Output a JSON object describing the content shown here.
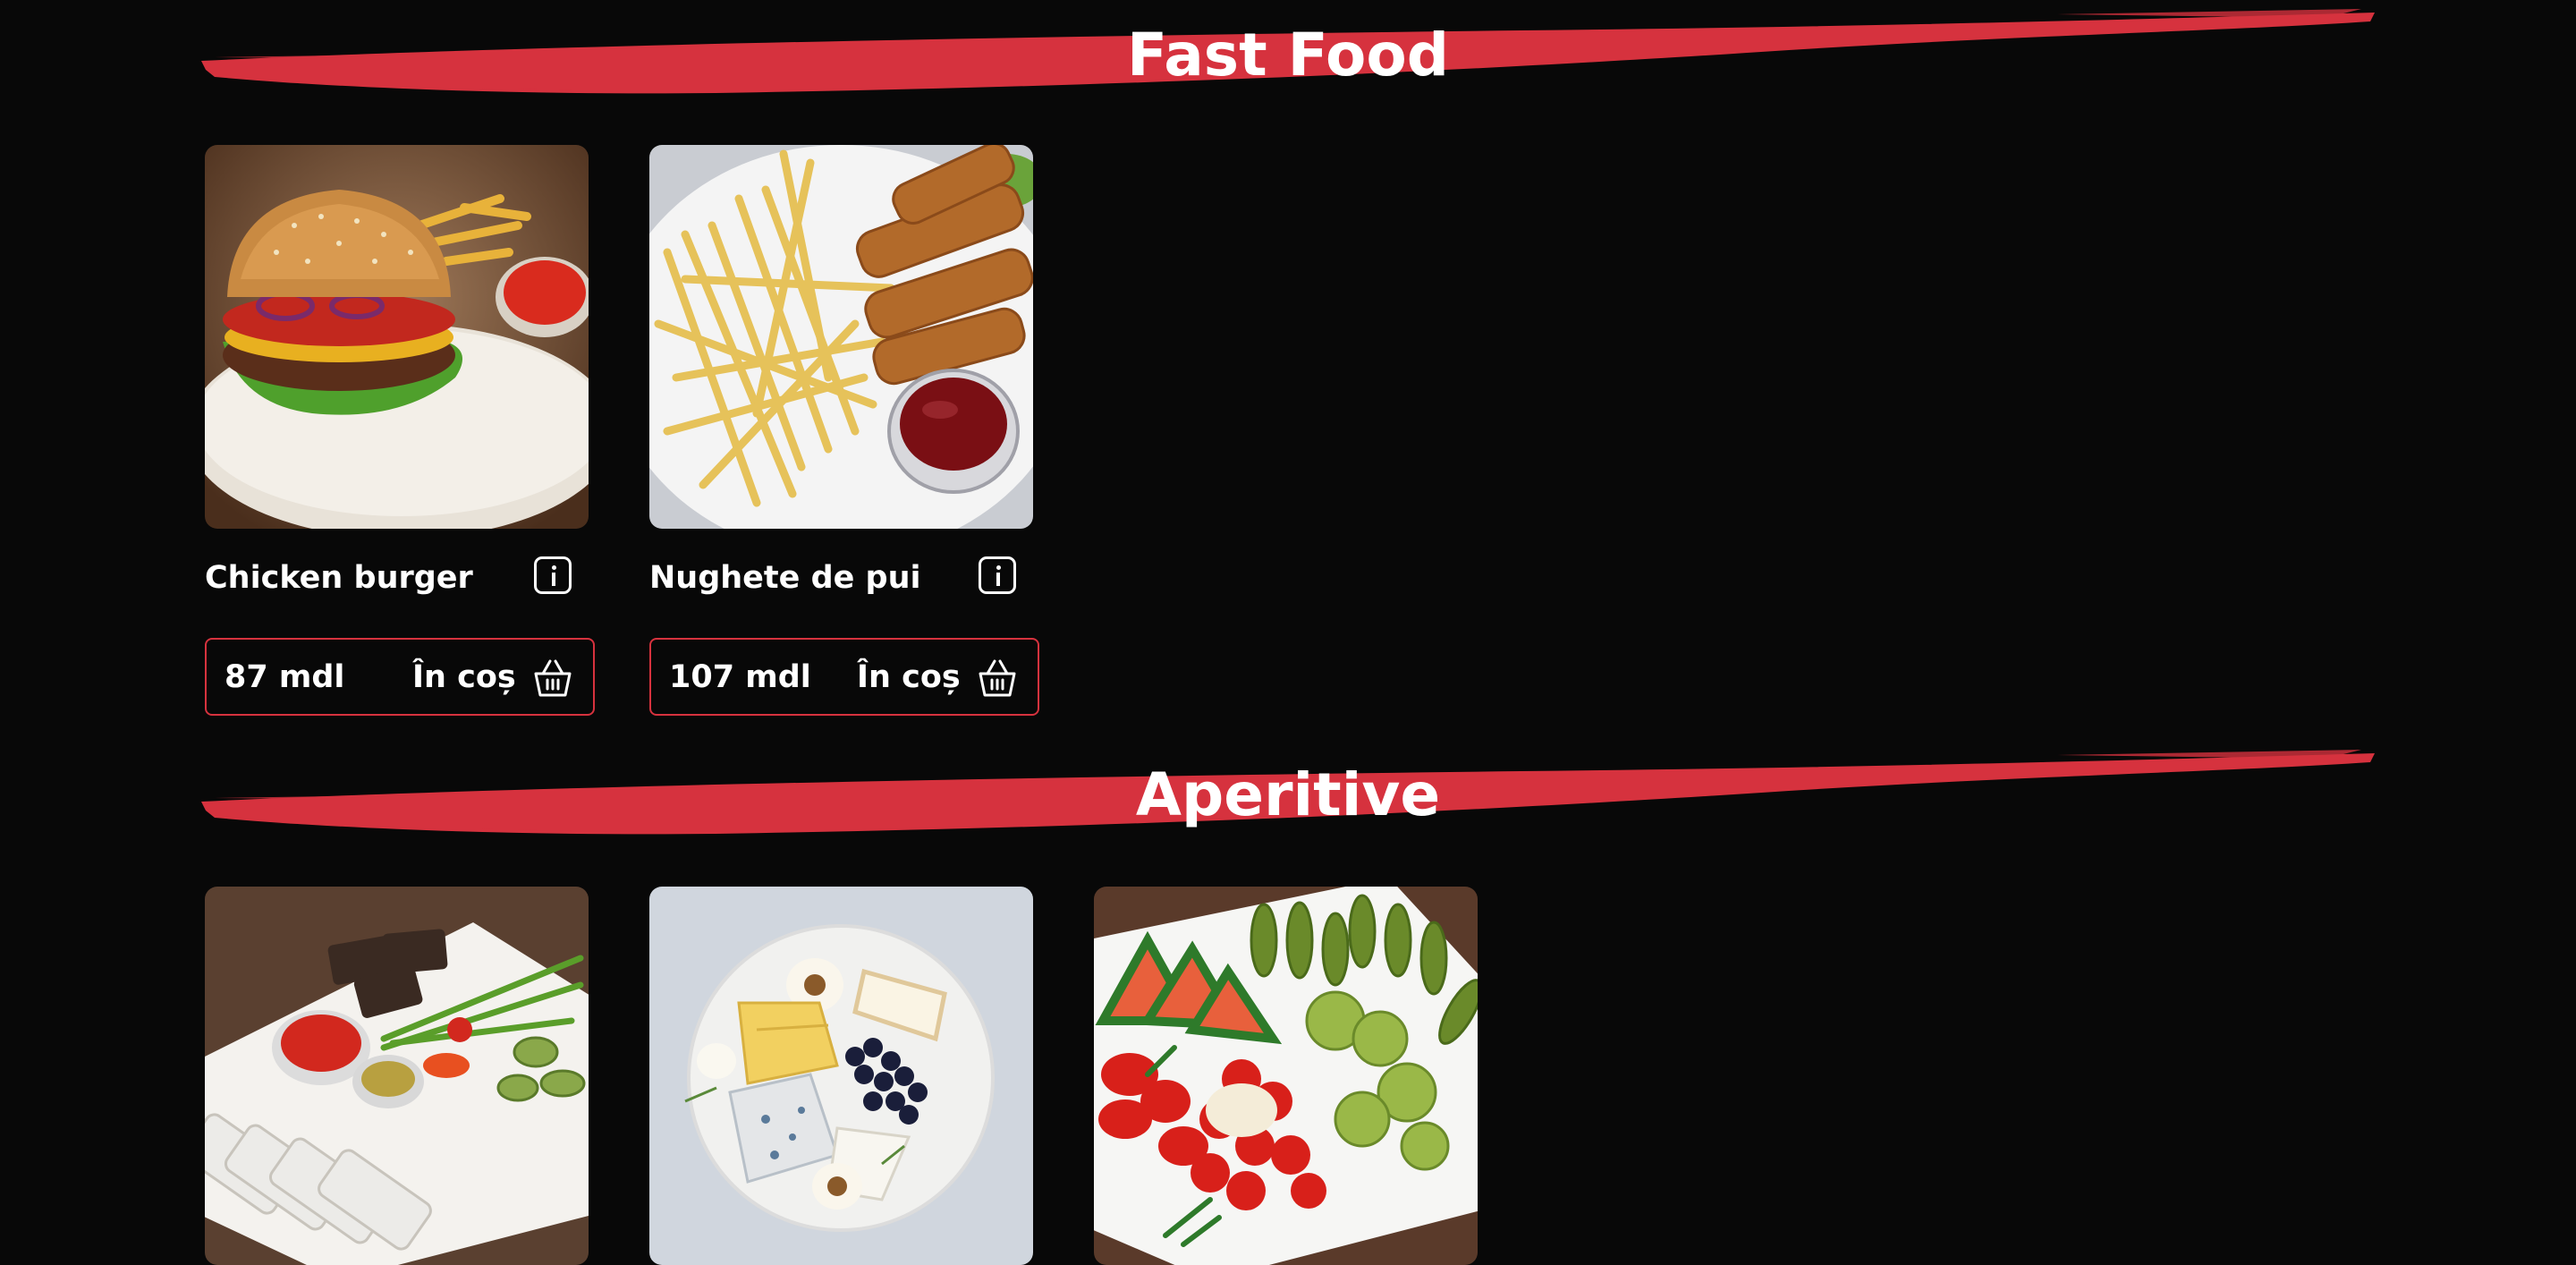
{
  "sections": [
    {
      "title": "Fast Food",
      "products": [
        {
          "name": "Chicken burger",
          "price": "87 mdl",
          "cart_label": "În coș",
          "image_icon": "burger-photo"
        },
        {
          "name": "Nughete de pui",
          "price": "107 mdl",
          "cart_label": "În coș",
          "image_icon": "nuggets-fries-photo"
        }
      ]
    },
    {
      "title": "Aperitive",
      "products": [
        {
          "name": "",
          "image_icon": "fish-platter-photo"
        },
        {
          "name": "",
          "image_icon": "cheese-plate-photo"
        },
        {
          "name": "",
          "image_icon": "pickles-platter-photo"
        }
      ]
    }
  ],
  "colors": {
    "background": "#080808",
    "accent_red": "#d6323e",
    "text": "#ffffff"
  },
  "icons": {
    "info": "info-icon",
    "cart": "basket-icon"
  }
}
